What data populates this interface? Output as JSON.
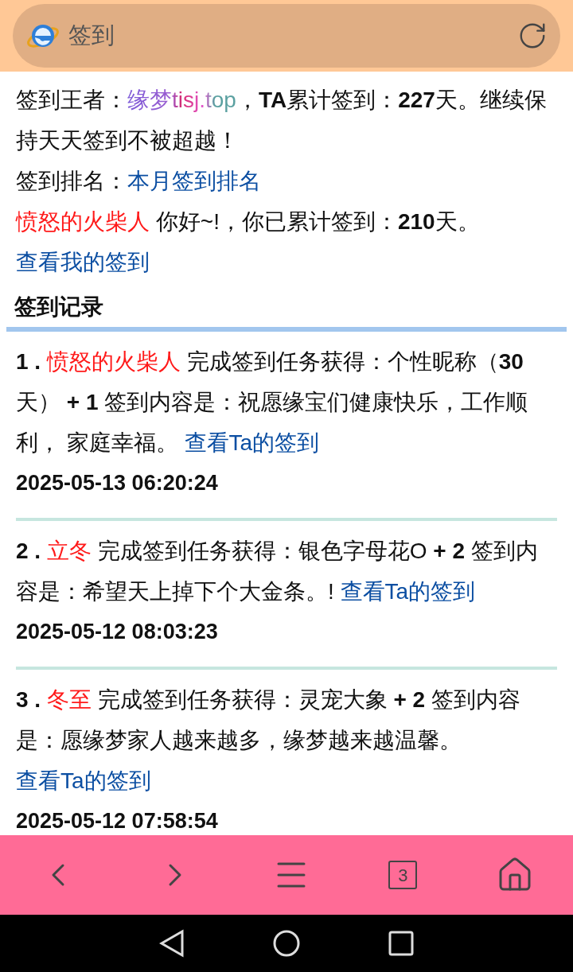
{
  "address_bar": {
    "title": "签到"
  },
  "king": {
    "label": "签到王者：",
    "site": "缘梦tisj.top",
    "text": "，**TA**累计签到：**227**天。继续保持天天签到不被超越！"
  },
  "ranking": {
    "label": "签到排名：",
    "link": "本月签到排名"
  },
  "greeting": {
    "user": "愤怒的火柴人",
    "text": " 你好~!，你已累计签到：**210**天。",
    "link": "查看我的签到"
  },
  "section_title": "签到记录",
  "records": [
    {
      "index": "1 .",
      "user": "愤怒的火柴人",
      "text": " 完成签到任务获得：个性昵称（**30**天） **+ 1** 签到内容是：祝愿缘宝们健康快乐，工作顺利， 家庭幸福。 ",
      "link": "查看Ta的签到",
      "time": "2025-05-13 06:20:24"
    },
    {
      "index": "2 .",
      "user": "立冬",
      "text": " 完成签到任务获得：银色字母花O **+ 2** 签到内容是：希望天上掉下个大金条。! ",
      "link": "查看Ta的签到",
      "time": "2025-05-12 08:03:23"
    },
    {
      "index": "3 .",
      "user": "冬至",
      "text": " 完成签到任务获得：灵宠大象 **+ 2** 签到内容是：愿缘梦家人越来越多，缘梦越来越温馨。 ",
      "link": "查看Ta的签到",
      "time": "2025-05-12 07:58:54"
    }
  ],
  "bottom_nav": {
    "tab_count": "3"
  }
}
